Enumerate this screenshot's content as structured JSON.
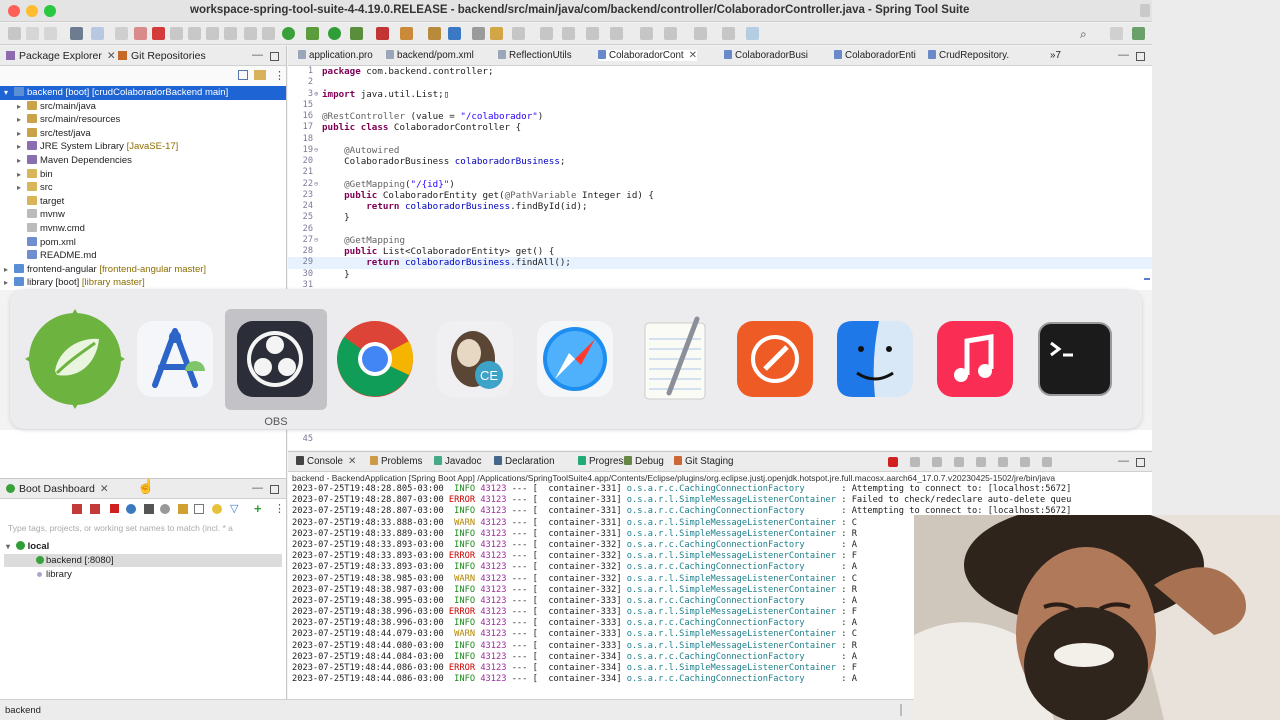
{
  "window": {
    "title": "workspace-spring-tool-suite-4-4.19.0.RELEASE - backend/src/main/java/com/backend/controller/ColaboradorController.java - Spring Tool Suite 4"
  },
  "left_panel": {
    "tabs": [
      {
        "label": "Package Explorer",
        "selected": true
      },
      {
        "label": "Git Repositories",
        "selected": false
      }
    ],
    "tree": [
      {
        "indent": 0,
        "arrow": "down",
        "label": "backend [boot] [crudColaboradorBackend main]",
        "selected": true,
        "icon_color": "#5a8fd6"
      },
      {
        "indent": 1,
        "arrow": "right",
        "label": "src/main/java",
        "icon_color": "#c9a24a"
      },
      {
        "indent": 1,
        "arrow": "right",
        "label": "src/main/resources",
        "icon_color": "#c9a24a"
      },
      {
        "indent": 1,
        "arrow": "right",
        "label": "src/test/java",
        "icon_color": "#c9a24a"
      },
      {
        "indent": 1,
        "arrow": "right",
        "label": "JRE System Library",
        "decoration": "[JavaSE-17]",
        "icon_color": "#8a6fb0"
      },
      {
        "indent": 1,
        "arrow": "right",
        "label": "Maven Dependencies",
        "icon_color": "#8a6fb0"
      },
      {
        "indent": 1,
        "arrow": "right",
        "label": "bin",
        "icon_color": "#d9b55a"
      },
      {
        "indent": 1,
        "arrow": "right",
        "label": "src",
        "icon_color": "#d9b55a"
      },
      {
        "indent": 1,
        "arrow": "",
        "label": "target",
        "icon_color": "#d9b55a"
      },
      {
        "indent": 1,
        "arrow": "",
        "label": "mvnw",
        "icon_color": "#bbbbbb"
      },
      {
        "indent": 1,
        "arrow": "",
        "label": "mvnw.cmd",
        "icon_color": "#bbbbbb"
      },
      {
        "indent": 1,
        "arrow": "",
        "label": "pom.xml",
        "icon_color": "#6e8ecf"
      },
      {
        "indent": 1,
        "arrow": "",
        "label": "README.md",
        "icon_color": "#6e8ecf"
      },
      {
        "indent": 0,
        "arrow": "right",
        "label": "frontend-angular",
        "decoration": "[frontend-angular master]",
        "icon_color": "#5a8fd6"
      },
      {
        "indent": 0,
        "arrow": "right",
        "label": "library [boot]",
        "decoration": "[library master]",
        "icon_color": "#5a8fd6"
      }
    ]
  },
  "editor": {
    "tabs": [
      {
        "label": "application.pro",
        "selected": false
      },
      {
        "label": "backend/pom.xml",
        "selected": false
      },
      {
        "label": "ReflectionUtils",
        "selected": false
      },
      {
        "label": "ColaboradorCont",
        "selected": true
      },
      {
        "label": "ColaboradorBusi",
        "selected": false
      },
      {
        "label": "ColaboradorEnti",
        "selected": false
      },
      {
        "label": "CrudRepository.",
        "selected": false
      },
      {
        "label": "»7",
        "selected": false
      }
    ],
    "lines": [
      {
        "n": "1",
        "fold": "",
        "segs": [
          [
            "kw",
            "package"
          ],
          [
            "",
            "com.backend.controller;"
          ]
        ]
      },
      {
        "n": "2",
        "fold": "",
        "segs": []
      },
      {
        "n": "3",
        "fold": "⊕",
        "segs": [
          [
            "kw",
            "import"
          ],
          [
            "",
            "java.util.List;▯"
          ]
        ]
      },
      {
        "n": "15",
        "fold": "",
        "segs": []
      },
      {
        "n": "16",
        "fold": "",
        "segs": [
          [
            "an",
            "@RestController"
          ],
          [
            "",
            "(value = "
          ],
          [
            "st",
            "\"/colaborador\""
          ],
          [
            "",
            ")"
          ]
        ]
      },
      {
        "n": "17",
        "fold": "",
        "segs": [
          [
            "kw",
            "public class"
          ],
          [
            "",
            "ColaboradorController {"
          ]
        ]
      },
      {
        "n": "18",
        "fold": "",
        "segs": []
      },
      {
        "n": "19",
        "fold": "⊖",
        "segs": [
          [
            "",
            "    "
          ],
          [
            "an",
            "@Autowired"
          ]
        ]
      },
      {
        "n": "20",
        "fold": "",
        "segs": [
          [
            "",
            "    ColaboradorBusiness "
          ],
          [
            "fd",
            "colaboradorBusiness"
          ],
          [
            "",
            ";"
          ]
        ]
      },
      {
        "n": "21",
        "fold": "",
        "segs": []
      },
      {
        "n": "22",
        "fold": "⊖",
        "segs": [
          [
            "",
            "    "
          ],
          [
            "an",
            "@GetMapping"
          ],
          [
            "",
            "("
          ],
          [
            "st",
            "\"/{id}\""
          ],
          [
            "",
            ")"
          ]
        ]
      },
      {
        "n": "23",
        "fold": "",
        "segs": [
          [
            "",
            "    "
          ],
          [
            "kw",
            "public"
          ],
          [
            "",
            "ColaboradorEntity get("
          ],
          [
            "an",
            "@PathVariable"
          ],
          [
            "",
            "Integer id) {"
          ]
        ]
      },
      {
        "n": "24",
        "fold": "",
        "segs": [
          [
            "",
            "        "
          ],
          [
            "kw",
            "return"
          ],
          [
            "fd",
            "colaboradorBusiness"
          ],
          [
            "",
            ".findById(id);"
          ]
        ]
      },
      {
        "n": "25",
        "fold": "",
        "segs": [
          [
            "",
            "    }"
          ]
        ]
      },
      {
        "n": "26",
        "fold": "",
        "segs": []
      },
      {
        "n": "27",
        "fold": "⊖",
        "segs": [
          [
            "",
            "    "
          ],
          [
            "an",
            "@GetMapping"
          ]
        ]
      },
      {
        "n": "28",
        "fold": "",
        "segs": [
          [
            "",
            "    "
          ],
          [
            "kw",
            "public"
          ],
          [
            "",
            "List<ColaboradorEntity> get() {"
          ]
        ]
      },
      {
        "n": "29",
        "fold": "",
        "cur": true,
        "segs": [
          [
            "",
            "        "
          ],
          [
            "kw",
            "return"
          ],
          [
            "fd",
            "colaboradorBusiness"
          ],
          [
            "",
            ".findAll();"
          ]
        ]
      },
      {
        "n": "30",
        "fold": "",
        "segs": [
          [
            "",
            "    }"
          ]
        ]
      },
      {
        "n": "31",
        "fold": "",
        "segs": []
      }
    ],
    "line_below_switcher": "45"
  },
  "app_switcher": {
    "selected_label": "OBS",
    "apps": [
      {
        "icon": "spring-tool-suite-icon"
      },
      {
        "icon": "android-studio-icon"
      },
      {
        "icon": "obs-icon"
      },
      {
        "icon": "chrome-icon"
      },
      {
        "icon": "dbeaver-icon"
      },
      {
        "icon": "safari-icon"
      },
      {
        "icon": "textedit-icon"
      },
      {
        "icon": "postman-icon"
      },
      {
        "icon": "finder-icon"
      },
      {
        "icon": "music-icon"
      },
      {
        "icon": "terminal-icon"
      }
    ]
  },
  "console": {
    "tabs": [
      {
        "label": "Console",
        "selected": true
      },
      {
        "label": "Problems"
      },
      {
        "label": "Javadoc"
      },
      {
        "label": "Declaration"
      },
      {
        "label": "Progress"
      },
      {
        "label": "Debug"
      },
      {
        "label": "Git Staging"
      }
    ],
    "path": "backend - BackendApplication [Spring Boot App] /Applications/SpringToolSuite4.app/Contents/Eclipse/plugins/org.eclipse.justj.openjdk.hotspot.jre.full.macosx.aarch64_17.0.7.v20230425-1502/jre/bin/java",
    "rows": [
      {
        "ts": "2023-07-25T19:48:28.805-03:00",
        "lvl": "INFO",
        "pid": "43123",
        "thr": "container-331",
        "logger": "o.s.a.r.c.CachingConnectionFactory",
        "msg": "Attempting to connect to: [localhost:5672]"
      },
      {
        "ts": "2023-07-25T19:48:28.807-03:00",
        "lvl": "ERROR",
        "pid": "43123",
        "thr": "container-331",
        "logger": "o.s.a.r.l.SimpleMessageListenerContainer",
        "msg": "Failed to check/redeclare auto-delete queu"
      },
      {
        "ts": "2023-07-25T19:48:28.807-03:00",
        "lvl": "INFO",
        "pid": "43123",
        "thr": "container-331",
        "logger": "o.s.a.r.c.CachingConnectionFactory",
        "msg": "Attempting to connect to: [localhost:5672]"
      },
      {
        "ts": "2023-07-25T19:48:33.888-03:00",
        "lvl": "WARN",
        "pid": "43123",
        "thr": "container-331",
        "logger": "o.s.a.r.l.SimpleMessageListenerContainer",
        "msg": "C"
      },
      {
        "ts": "2023-07-25T19:48:33.889-03:00",
        "lvl": "INFO",
        "pid": "43123",
        "thr": "container-331",
        "logger": "o.s.a.r.l.SimpleMessageListenerContainer",
        "msg": "R"
      },
      {
        "ts": "2023-07-25T19:48:33.893-03:00",
        "lvl": "INFO",
        "pid": "43123",
        "thr": "container-332",
        "logger": "o.s.a.r.c.CachingConnectionFactory",
        "msg": "A"
      },
      {
        "ts": "2023-07-25T19:48:33.893-03:00",
        "lvl": "ERROR",
        "pid": "43123",
        "thr": "container-332",
        "logger": "o.s.a.r.l.SimpleMessageListenerContainer",
        "msg": "F"
      },
      {
        "ts": "2023-07-25T19:48:33.893-03:00",
        "lvl": "INFO",
        "pid": "43123",
        "thr": "container-332",
        "logger": "o.s.a.r.c.CachingConnectionFactory",
        "msg": "A"
      },
      {
        "ts": "2023-07-25T19:48:38.985-03:00",
        "lvl": "WARN",
        "pid": "43123",
        "thr": "container-332",
        "logger": "o.s.a.r.l.SimpleMessageListenerContainer",
        "msg": "C"
      },
      {
        "ts": "2023-07-25T19:48:38.987-03:00",
        "lvl": "INFO",
        "pid": "43123",
        "thr": "container-332",
        "logger": "o.s.a.r.l.SimpleMessageListenerContainer",
        "msg": "R"
      },
      {
        "ts": "2023-07-25T19:48:38.995-03:00",
        "lvl": "INFO",
        "pid": "43123",
        "thr": "container-333",
        "logger": "o.s.a.r.c.CachingConnectionFactory",
        "msg": "A"
      },
      {
        "ts": "2023-07-25T19:48:38.996-03:00",
        "lvl": "ERROR",
        "pid": "43123",
        "thr": "container-333",
        "logger": "o.s.a.r.l.SimpleMessageListenerContainer",
        "msg": "F"
      },
      {
        "ts": "2023-07-25T19:48:38.996-03:00",
        "lvl": "INFO",
        "pid": "43123",
        "thr": "container-333",
        "logger": "o.s.a.r.c.CachingConnectionFactory",
        "msg": "A"
      },
      {
        "ts": "2023-07-25T19:48:44.079-03:00",
        "lvl": "WARN",
        "pid": "43123",
        "thr": "container-333",
        "logger": "o.s.a.r.l.SimpleMessageListenerContainer",
        "msg": "C"
      },
      {
        "ts": "2023-07-25T19:48:44.080-03:00",
        "lvl": "INFO",
        "pid": "43123",
        "thr": "container-333",
        "logger": "o.s.a.r.l.SimpleMessageListenerContainer",
        "msg": "R"
      },
      {
        "ts": "2023-07-25T19:48:44.084-03:00",
        "lvl": "INFO",
        "pid": "43123",
        "thr": "container-334",
        "logger": "o.s.a.r.c.CachingConnectionFactory",
        "msg": "A"
      },
      {
        "ts": "2023-07-25T19:48:44.086-03:00",
        "lvl": "ERROR",
        "pid": "43123",
        "thr": "container-334",
        "logger": "o.s.a.r.l.SimpleMessageListenerContainer",
        "msg": "F"
      },
      {
        "ts": "2023-07-25T19:48:44.086-03:00",
        "lvl": "INFO",
        "pid": "43123",
        "thr": "container-334",
        "logger": "o.s.a.r.c.CachingConnectionFactory",
        "msg": "A"
      }
    ]
  },
  "boot_dashboard": {
    "tab": "Boot Dashboard",
    "filter_placeholder": "Type tags, projects, or working set names to match (incl. * a",
    "group": "local",
    "items": [
      {
        "label": "backend [:8080]",
        "running": true,
        "selected": true
      },
      {
        "label": "library",
        "running": false,
        "selected": false
      }
    ]
  },
  "status_bar": {
    "text": "backend"
  }
}
